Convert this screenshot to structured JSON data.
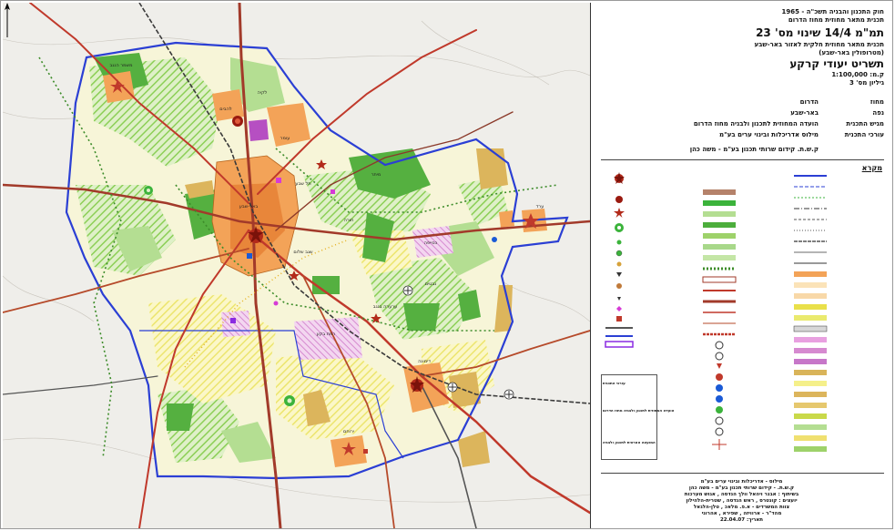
{
  "header": {
    "line1": "חוק התכנון והבניה תשכ\"ה - 1965",
    "line2": "תכנית מתאר מחוזית מחוז הדרום",
    "title": "תמ\"מ 14/4 שינוי מס' 23",
    "subtitle1": "תכנית מתאר מחוזית חלקית לאזור באר-שבע",
    "subtitle2": "(מטרופולין באר-שבע)",
    "sheet_title": "תשריט יעודי קרקע",
    "scale": "ק.מ: 1:100,000",
    "sheet_no": "גיליון מס' 3"
  },
  "info": [
    {
      "key": "מחוז",
      "value": "הדרום"
    },
    {
      "key": "נפה",
      "value": "באר-שבע"
    },
    {
      "key": "מגיש התכנית",
      "value": "הועדה המחוזית לתכנון ולבניה מחוז הדרום"
    },
    {
      "key": "עורכי התכנית",
      "value": "מילוס אדריכלות ובינוי ערים בע\"מ"
    },
    {
      "key": "",
      "value": "ק.ש.ת. קידום שרותי תכנון בע\"מ - משה כהן"
    }
  ],
  "legend": {
    "title": "מקרא"
  },
  "signatures": [
    {
      "label": "עורכי התכנית"
    },
    {
      "label": "הועדה המחוזית לתכנון ולבניה מחוז הדרום"
    },
    {
      "label": "המועצה הארצית לתכנון ולבניה"
    }
  ],
  "footer": {
    "line1": "מילוס - אדריכלות ובינוי ערים בע\"מ",
    "line2": "ק.ש.ת. - קידום שרותי תכנון בע\"מ - משה כהן",
    "line3": "בשיתוף : אבנר ויהאל וולך הנדסה , אגוש מערכות",
    "line4": "יועצים : קונטרס , ראש הנדסה , שטרית-הלהילון",
    "line5": "צוות המשרדים - א.פ. מלאכ , טלן-הלגאל",
    "line6": "מהד\"ר - ארוויזה , שפירא , אהרוני",
    "date": "תאריך: 22.04.07"
  },
  "map_labels": [
    {
      "text": "באר-שבע"
    },
    {
      "text": "ערד"
    },
    {
      "text": "דימונה"
    },
    {
      "text": "ירוחם"
    },
    {
      "text": "נבטים"
    },
    {
      "text": "חוּרה"
    },
    {
      "text": "שגב שלום"
    },
    {
      "text": "רמת בקע"
    },
    {
      "text": "עומר"
    },
    {
      "text": "להבים"
    },
    {
      "text": "משמר הנגב"
    },
    {
      "text": "ערערה בנגב"
    },
    {
      "text": "כסייפה"
    },
    {
      "text": "תל שבע"
    },
    {
      "text": "לקיה"
    },
    {
      "text": "מיתר"
    }
  ],
  "colors": {
    "urban": "#f4a55a",
    "urban_core": "#e98a3e",
    "green_dark": "#4cae3c",
    "green_light": "#a8d88a",
    "hatch_green": "#9ed26a",
    "hatch_yellow": "#f5f08a",
    "pink": "#e8a0e0",
    "tan": "#d9b45a",
    "border_blue": "#2b3fd4",
    "road_red": "#c0392b",
    "road_brown": "#8b3a2a",
    "rail": "#555555"
  }
}
